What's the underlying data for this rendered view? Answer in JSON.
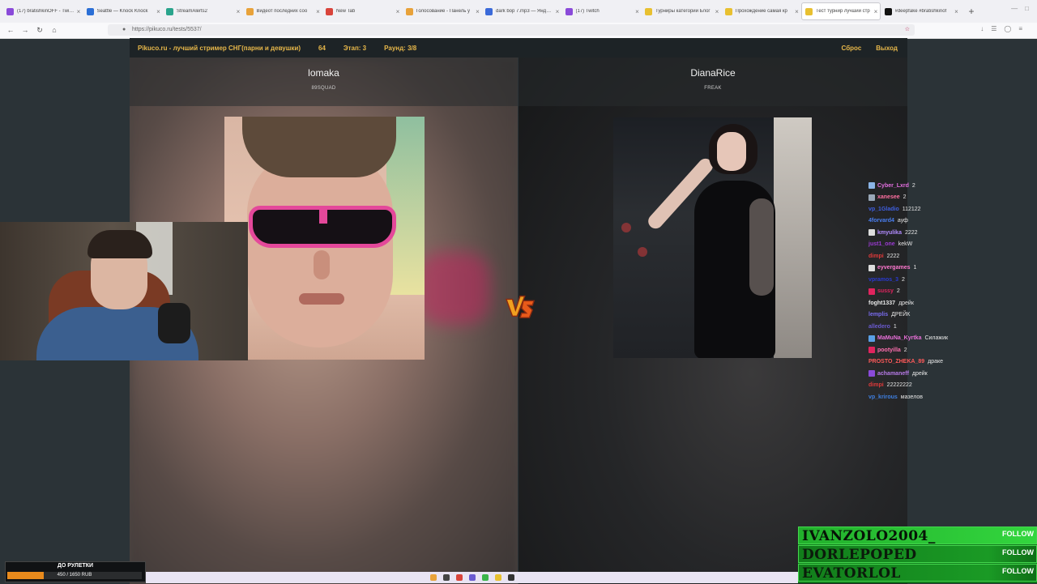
{
  "browser": {
    "tabs": [
      {
        "title": "(17) bratishkinOFF - Twitch",
        "fav": "#8a4ad9"
      },
      {
        "title": "Seattle — Knock Knock",
        "fav": "#2b6fd6"
      },
      {
        "title": "StreamAlerts2",
        "fav": "#2aa48c"
      },
      {
        "title": "Видеот последних соо",
        "fav": "#e8a23a"
      },
      {
        "title": "New Tab",
        "fav": "#d9443b"
      },
      {
        "title": "Голосование - Панель у",
        "fav": "#e8a23a"
      },
      {
        "title": "dark bop 7.mp3 — Яндекс",
        "fav": "#3b6ad9"
      },
      {
        "title": "(17) Twitch",
        "fav": "#8a4ad9"
      },
      {
        "title": "Турниры категории Блог",
        "fav": "#e8c030"
      },
      {
        "title": "Прохождение самая кр",
        "fav": "#e8c030"
      },
      {
        "title": "Тест турнир лучший стр",
        "fav": "#e8c030"
      },
      {
        "title": "#deepfake #bratishkinof",
        "fav": "#111111"
      }
    ],
    "url": "https://pikuco.ru/tests/5537/"
  },
  "site": {
    "brand": "Pikuco.ru - лучший стример СНГ(парни и девушки)",
    "count": "64",
    "stage": "Этап: 3",
    "round": "Раунд: 3/8",
    "reset": "Сброс",
    "exit": "Выход"
  },
  "contestants": {
    "left": {
      "name": "lomaka",
      "team": "89SQUAD"
    },
    "right": {
      "name": "DianaRice",
      "team": "FREAK"
    }
  },
  "chat": [
    {
      "user": "Cyber_Lxrd",
      "msg": "2",
      "color": "#e36fe0",
      "badge": "#8ab4e6"
    },
    {
      "user": "xanesee",
      "msg": "2",
      "color": "#ff6fa0",
      "badge": "#9aa8b8"
    },
    {
      "user": "vp_1Gladio",
      "msg": "112122",
      "color": "#3f5fe0",
      "badge": ""
    },
    {
      "user": "4forvard4",
      "msg": "ауф",
      "color": "#4a7ef0",
      "badge": ""
    },
    {
      "user": "kmyulika",
      "msg": "2222",
      "color": "#b28bff",
      "badge": "#dddddd"
    },
    {
      "user": "just1_one",
      "msg": "kekW",
      "color": "#9a3ad0",
      "badge": ""
    },
    {
      "user": "dimpi",
      "msg": "2222",
      "color": "#e03a3a",
      "badge": ""
    },
    {
      "user": "eyvergames",
      "msg": "1",
      "color": "#ff79d0",
      "badge": "#dddddd"
    },
    {
      "user": "vpramos_3",
      "msg": "2",
      "color": "#2a3ad0",
      "badge": ""
    },
    {
      "user": "sussy",
      "msg": "2",
      "color": "#e0245e",
      "badge": "#e0245e"
    },
    {
      "user": "foght1337",
      "msg": "дрейк",
      "color": "#e6e6e6",
      "badge": ""
    },
    {
      "user": "lemplis",
      "msg": "ДРЕЙК",
      "color": "#7a6cf0",
      "badge": ""
    },
    {
      "user": "alledero",
      "msg": "1",
      "color": "#6a5ad0",
      "badge": ""
    },
    {
      "user": "MaMuNa_Kyrtka",
      "msg": "Силажик",
      "color": "#e86fd8",
      "badge": "#5aa0e6"
    },
    {
      "user": "pootyilla",
      "msg": "2",
      "color": "#ff6fb0",
      "badge": "#e0245e"
    },
    {
      "user": "PROSTO_ZHEKA_89",
      "msg": "драке",
      "color": "#ff5a5a",
      "badge": ""
    },
    {
      "user": "achamaneff",
      "msg": "дрейк",
      "color": "#b67ae6",
      "badge": "#8a4ad9"
    },
    {
      "user": "dimpi",
      "msg": "22222222",
      "color": "#e03a3a",
      "badge": ""
    },
    {
      "user": "vp_krirous",
      "msg": "мазелов",
      "color": "#3f7fe0",
      "badge": ""
    }
  ],
  "follows": [
    {
      "name": "IVANZOLO2004_",
      "label": "FOLLOW"
    },
    {
      "name": "DORLEPOPED",
      "label": "FOLLOW"
    },
    {
      "name": "EVATORLOL",
      "label": "FOLLOW"
    }
  ],
  "roulette": {
    "title": "ДО РУЛЕТКИ",
    "value_text": "450 / 1650 RUB",
    "progress": 0.273
  },
  "taskbar_colors": [
    "#e8a23a",
    "#444444",
    "#d9443b",
    "#6a5ad0",
    "#3bb54a",
    "#e8c030",
    "#333333"
  ]
}
